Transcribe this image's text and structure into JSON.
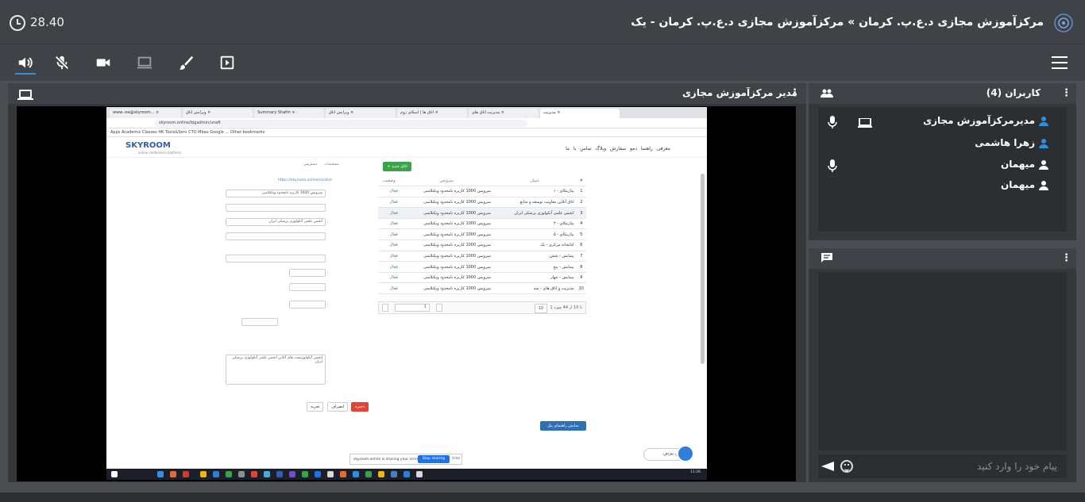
{
  "header": {
    "timer": "28.40",
    "room_title": "مرکزآموزش مجازی د.ع.پ. کرمان » مرکزآموزش مجازی د.ع.پ. کرمان - یک"
  },
  "toolbar": {
    "items": [
      "speaker-icon",
      "mic-muted-icon",
      "camera-icon",
      "screen-share-icon",
      "brush-icon",
      "play-media-icon"
    ],
    "accent_color": "#2f8fd8"
  },
  "share": {
    "title": "مدیر مرکزآموزش مجازی"
  },
  "shared_screen": {
    "browser_tabs": [
      "www.-oe@skyroom... ×",
      "ویرایش اتاق ×",
      "Summary Shafm ×",
      "ویرایش اتاق ×",
      "اتاق ها | اسکای روم ×",
      "مدیریت اتاق های ×",
      "مدیریت ×"
    ],
    "url": "skyroom.online/bigadmin/unaft",
    "bookmarks": "Apps  Academic  Classes  HK  Tools&Serv  CTO  Mbax  Google  ...  Other bookmarks",
    "logo_text": "SKYROOM",
    "logo_sub": "online conference platform",
    "nav": "معرفی  راهنما  دمو  سفارش  وبلاگ  تماس با ما",
    "add_button": "+ اتاق جدید",
    "table": {
      "headers": [
        "#",
        "عنوان",
        "سرویس",
        "وضعیت"
      ],
      "rows": [
        [
          "1",
          "پیاژینکای - ۱",
          "سرویس 1000 کاربره نامحدود ویکتلاسی",
          "فعال"
        ],
        [
          "2",
          "اتاق آنلاین معاونت توسعه و منابع",
          "سرویس 1000 کاربره نامحدود ویکتلاسی",
          "فعال"
        ],
        [
          "3",
          "انجمن علمی آنکولوژی پزشکی ایران",
          "سرویس 1000 کاربره نامحدود ویکتلاسی",
          "فعال"
        ],
        [
          "4",
          "پیاژینکای - ۴",
          "سرویس 1000 کاربره نامحدود ویکتلاسی",
          "فعال"
        ],
        [
          "5",
          "پیاژینکای - ۵",
          "سرویس 1000 کاربره نامحدود ویکتلاسی",
          "فعال"
        ],
        [
          "6",
          "کتابخانه مرکزی - یک",
          "سرویس 1000 کاربره نامحدود ویکتلاسی",
          "فعال"
        ],
        [
          "7",
          "پیمایش - شش",
          "سرویس 1000 کاربره نامحدود ویکتلاسی",
          "فعال"
        ],
        [
          "8",
          "پیمایش - پنج",
          "سرویس 1000 کاربره نامحدود ویکتلاسی",
          "فعال"
        ],
        [
          "9",
          "پیمایش - چهار",
          "سرویس 1000 کاربره نامحدود ویکتلاسی",
          "فعال"
        ],
        [
          "10",
          "مدیریت و اتاق های - سه",
          "سرویس 1000 کاربره نامحدود ویکتلاسی",
          "فعال"
        ]
      ],
      "pager": "1 تا 10 از 44 مورد",
      "page_size": "10",
      "page_value": "1"
    },
    "form": {
      "tabs": [
        "مشخصات",
        "دسترسی"
      ],
      "url_value": "https://skyroom.online/ch/skm",
      "service_value": "سرویس 1000 کاربره نامحدود ویکتلاسی",
      "title_value": "انجمن علمی آنکولوژی پزشکی ایران",
      "description_text": "انجمن آنکولوژیست های آنلاین انجمن علمی آنکولوژی پزشکی ایران"
    },
    "form_buttons": [
      "ذخیره",
      "انصراف",
      "تجزیه"
    ],
    "guide_button": "نمایش راهنمای پنل",
    "sharebar_text": "skyroom.online is sharing your screen",
    "stop_share": "Stop sharing",
    "hide_share": "Hide",
    "chat_bubble": "از من بپرس",
    "tray_time": "11:26"
  },
  "users": {
    "title": "کاربران (4)",
    "list": [
      {
        "name": "مدیرمرکزآموزش مجازی",
        "has_mic": true,
        "has_screen": true
      },
      {
        "name": "زهرا هاشمی",
        "has_mic": false,
        "has_screen": false
      },
      {
        "name": "میهمان",
        "has_mic": true,
        "has_screen": false
      },
      {
        "name": "میهمان",
        "has_mic": false,
        "has_screen": false
      }
    ]
  },
  "chat": {
    "input_placeholder": "پیام خود را وارد کنید"
  }
}
